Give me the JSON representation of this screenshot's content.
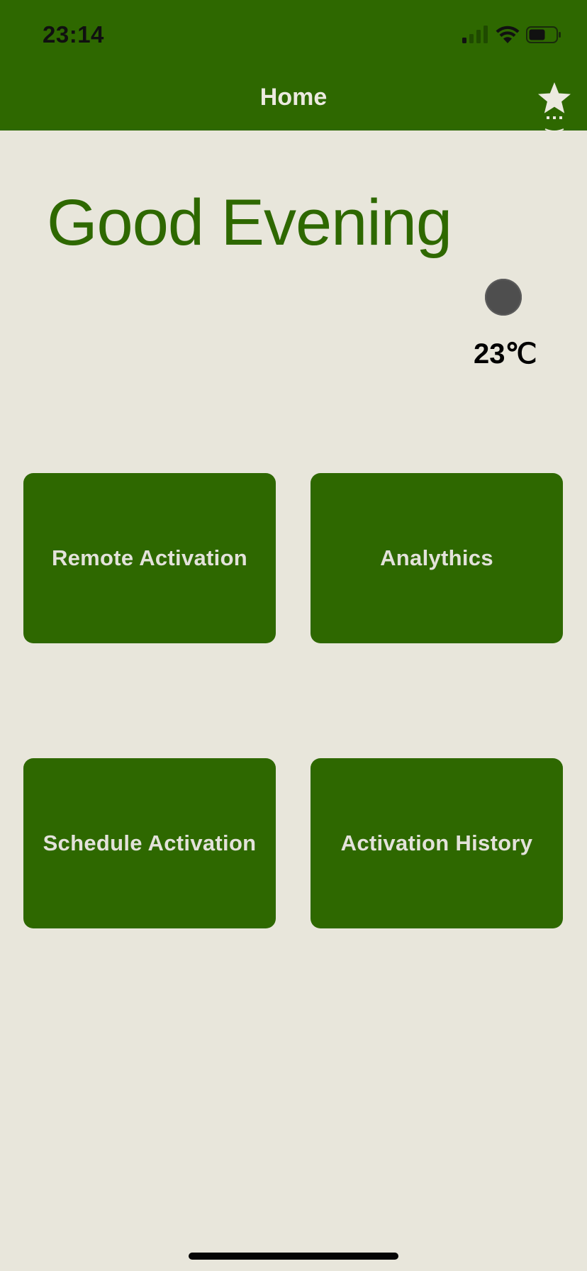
{
  "colors": {
    "header_bg": "#2E6800",
    "page_bg": "#E8E6DB",
    "accent": "#2E6800",
    "tile_text": "#E3E2DA"
  },
  "status_bar": {
    "time": "23:14",
    "icons": [
      "cellular-signal-icon",
      "wifi-icon",
      "battery-icon"
    ]
  },
  "nav": {
    "title": "Home",
    "right_icon": "star-icon"
  },
  "greeting": "Good Evening",
  "weather": {
    "icon": "weather-icon",
    "temperature": "23℃"
  },
  "tiles": [
    {
      "label": "Remote Activation"
    },
    {
      "label": "Analythics"
    },
    {
      "label": "Schedule Activation"
    },
    {
      "label": "Activation History"
    }
  ]
}
